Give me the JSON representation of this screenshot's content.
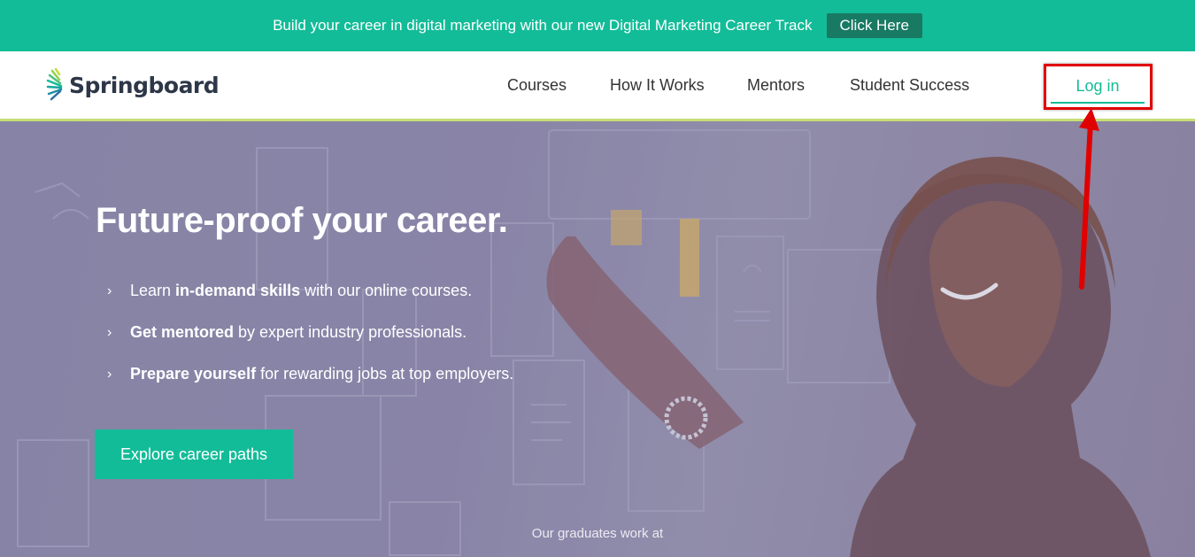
{
  "promo": {
    "text": "Build your career in digital marketing with our new Digital Marketing Career Track",
    "cta_label": "Click Here"
  },
  "brand": {
    "name": "Springboard",
    "logo_icon": "springboard-leaf-icon",
    "accent_color": "#13bc98",
    "dark_accent_color": "#187a63",
    "highlight_color": "#e10000"
  },
  "nav": {
    "items": [
      {
        "label": "Courses"
      },
      {
        "label": "How It Works"
      },
      {
        "label": "Mentors"
      },
      {
        "label": "Student Success"
      }
    ],
    "login_label": "Log in"
  },
  "hero": {
    "title": "Future-proof your career.",
    "bullets": [
      {
        "pre": "Learn ",
        "bold": "in-demand skills",
        "post": " with our online courses."
      },
      {
        "pre": "",
        "bold": "Get mentored",
        "post": " by expert industry professionals."
      },
      {
        "pre": "",
        "bold": "Prepare yourself",
        "post": " for rewarding jobs at top employers."
      }
    ],
    "cta_label": "Explore career paths",
    "graduates_text": "Our graduates work at"
  }
}
